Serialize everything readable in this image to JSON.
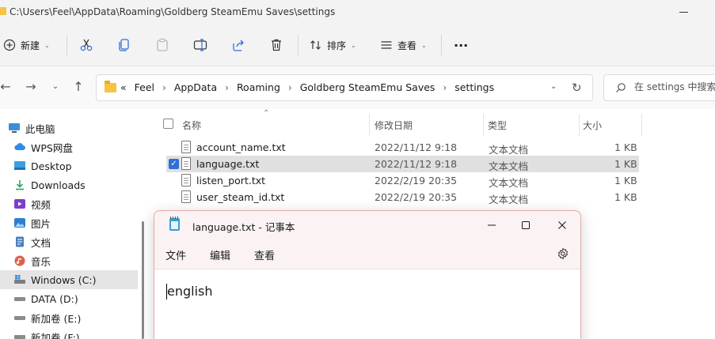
{
  "explorer": {
    "title": "C:\\Users\\Feel\\AppData\\Roaming\\Goldberg SteamEmu Saves\\settings",
    "toolbar": {
      "new_label": "新建",
      "sort_label": "排序",
      "view_label": "查看",
      "more_label": "···"
    },
    "address": {
      "overflow": "«",
      "crumbs": [
        "Feel",
        "AppData",
        "Roaming",
        "Goldberg SteamEmu Saves",
        "settings"
      ]
    },
    "search": {
      "placeholder": "在 settings 中搜索"
    },
    "sidebar": {
      "items": [
        {
          "label": "此电脑",
          "icon": "computer-icon"
        },
        {
          "label": "WPS网盘",
          "icon": "cloud-icon"
        },
        {
          "label": "Desktop",
          "icon": "desktop-icon"
        },
        {
          "label": "Downloads",
          "icon": "download-icon"
        },
        {
          "label": "视频",
          "icon": "video-icon"
        },
        {
          "label": "图片",
          "icon": "picture-icon"
        },
        {
          "label": "文档",
          "icon": "document-icon"
        },
        {
          "label": "音乐",
          "icon": "music-icon"
        },
        {
          "label": "Windows (C:)",
          "icon": "drive-icon",
          "selected": true
        },
        {
          "label": "DATA (D:)",
          "icon": "drive-icon"
        },
        {
          "label": "新加卷 (E:)",
          "icon": "drive-icon"
        },
        {
          "label": "新加卷 (F:)",
          "icon": "drive-icon"
        }
      ]
    },
    "columns": {
      "name": "名称",
      "modified": "修改日期",
      "type": "类型",
      "size": "大小"
    },
    "files": [
      {
        "name": "account_name.txt",
        "modified": "2022/11/12 9:18",
        "type": "文本文档",
        "size": "1 KB",
        "selected": false
      },
      {
        "name": "language.txt",
        "modified": "2022/11/12 9:18",
        "type": "文本文档",
        "size": "1 KB",
        "selected": true
      },
      {
        "name": "listen_port.txt",
        "modified": "2022/2/19 20:35",
        "type": "文本文档",
        "size": "1 KB",
        "selected": false
      },
      {
        "name": "user_steam_id.txt",
        "modified": "2022/2/19 20:35",
        "type": "文本文档",
        "size": "1 KB",
        "selected": false
      }
    ]
  },
  "notepad": {
    "title": "language.txt - 记事本",
    "menu": {
      "file": "文件",
      "edit": "编辑",
      "view": "查看"
    },
    "content": "english",
    "accent": "#3a9bdc"
  },
  "colors": {
    "folder": "#f6c342",
    "selection_check": "#2f6fd6"
  }
}
